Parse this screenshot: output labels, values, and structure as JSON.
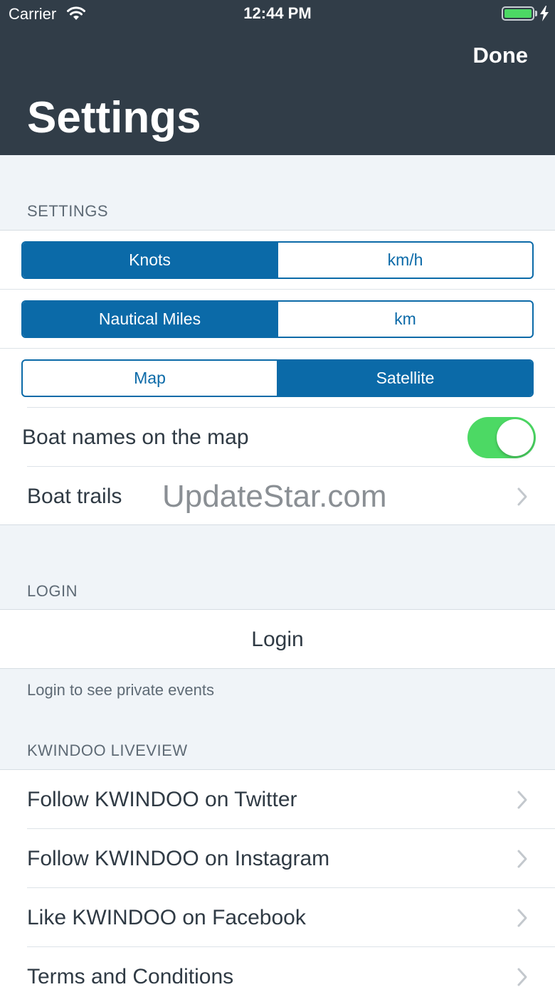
{
  "status_bar": {
    "carrier": "Carrier",
    "time": "12:44 PM",
    "battery_color": "#4cd964"
  },
  "nav": {
    "done_label": "Done",
    "title": "Settings"
  },
  "settings_section": {
    "header": "SETTINGS",
    "speed_units": {
      "options": [
        "Knots",
        "km/h"
      ],
      "selected": "Knots"
    },
    "distance_units": {
      "options": [
        "Nautical Miles",
        "km"
      ],
      "selected": "Nautical Miles"
    },
    "map_type": {
      "options": [
        "Map",
        "Satellite"
      ],
      "selected": "Satellite"
    },
    "boat_names": {
      "label": "Boat names on the map",
      "enabled": true
    },
    "boat_trails": {
      "label": "Boat trails"
    }
  },
  "watermark": "UpdateStar.com",
  "login_section": {
    "header": "LOGIN",
    "button_label": "Login",
    "footer": "Login to see private events"
  },
  "liveview_section": {
    "header": "KWINDOO LIVEVIEW",
    "items": [
      {
        "label": "Follow KWINDOO on Twitter"
      },
      {
        "label": "Follow KWINDOO on Instagram"
      },
      {
        "label": "Like KWINDOO on Facebook"
      },
      {
        "label": "Terms and Conditions"
      }
    ]
  },
  "colors": {
    "header_bg": "#313d48",
    "accent": "#0b6aa8",
    "toggle_on": "#4cd964",
    "page_bg": "#f0f4f8"
  }
}
